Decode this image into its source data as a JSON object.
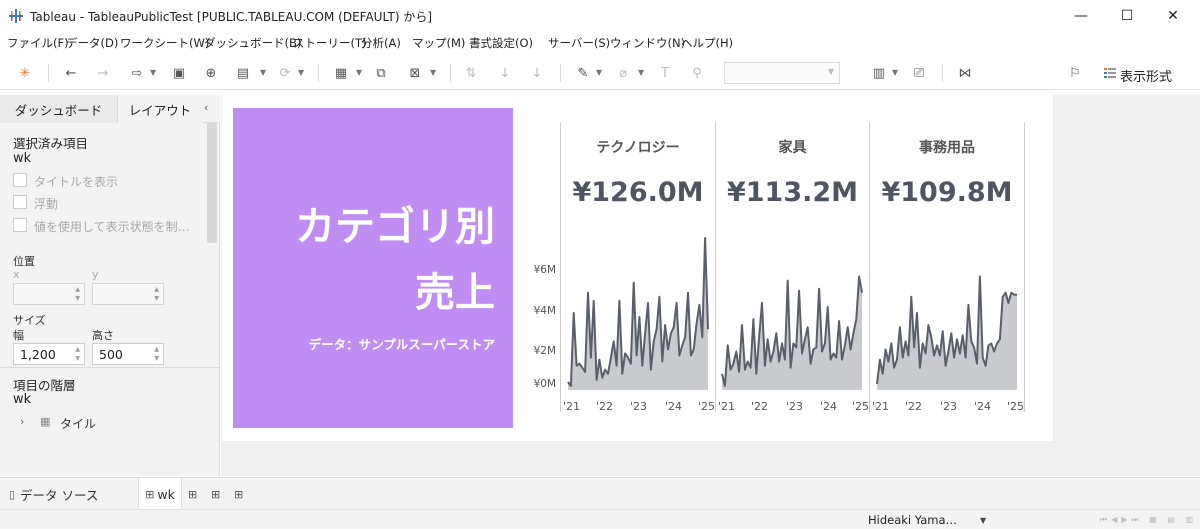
{
  "window": {
    "title": "Tableau - TableauPublicTest [PUBLIC.TABLEAU.COM (DEFAULT) から]",
    "minimize": "—",
    "maximize": "☐",
    "close": "✕"
  },
  "menu": [
    "ファイル(F)",
    "データ(D)",
    "ワークシート(W)",
    "ダッシュボード(B)",
    "ストーリー(T)",
    "分析(A)",
    "マップ(M)",
    "書式設定(O)",
    "サーバー(S)",
    "ウィンドウ(N)",
    "ヘルプ(H)"
  ],
  "toolbar": {
    "show_me_label": "表示形式",
    "icons": [
      "tableau-logo-icon",
      "back-icon",
      "forward-icon",
      "redo-icon",
      "save-icon",
      "new-datasource-icon",
      "pause-icon",
      "refresh-icon",
      "new-sheet-icon",
      "duplicate-icon",
      "clear-icon",
      "swap-icon",
      "sort-asc-icon",
      "sort-desc-icon",
      "highlight-icon",
      "paperclip-icon",
      "text-icon",
      "pin-icon",
      "presentation-icon",
      "device-preview-icon",
      "share-icon",
      "format-icon"
    ]
  },
  "left_pane": {
    "tabs": [
      "ダッシュボード",
      "レイアウト"
    ],
    "active_tab": "レイアウト",
    "selected_item_header": "選択済み項目",
    "selected_item_value": "wk",
    "checkboxes": [
      "タイトルを表示",
      "浮動",
      "値を使用して表示状態を制…"
    ],
    "position_label": "位置",
    "x_label": "x",
    "y_label": "y",
    "size_label": "サイズ",
    "width_label": "幅",
    "height_label": "高さ",
    "width_value": "1,200",
    "height_value": "500",
    "hierarchy_header": "項目の階層",
    "hierarchy_value": "wk",
    "hierarchy_child": "タイル"
  },
  "dashboard": {
    "title_line1": "カテゴリ別",
    "title_line2": "売上",
    "subtitle": "データ：サンプルスーパーストア",
    "accent": "#c08ef2",
    "line_color": "#5a6069",
    "fill_color": "#c9cbcf"
  },
  "chart_data": [
    {
      "type": "area",
      "title": "テクノロジー",
      "kpi": "¥126.0M",
      "x_ticks": [
        "'21",
        "'22",
        "'23",
        "'24",
        "'25"
      ],
      "y_ticks": [
        "¥0M",
        "¥2M",
        "¥4M",
        "¥6M"
      ],
      "ylim": [
        0,
        7.5
      ],
      "values": [
        0.4,
        0.2,
        3.8,
        1.2,
        1.3,
        1.1,
        0.9,
        4.8,
        1.6,
        4.4,
        0.5,
        1.5,
        0.6,
        1.0,
        0.8,
        1.6,
        2.4,
        1.2,
        4.4,
        0.8,
        1.8,
        1.6,
        1.3,
        5.3,
        1.7,
        3.6,
        1.2,
        2.8,
        4.3,
        1.0,
        2.4,
        3.0,
        4.6,
        1.4,
        3.2,
        2.0,
        2.8,
        3.1,
        4.3,
        1.7,
        2.2,
        2.6,
        4.8,
        1.7,
        2.0,
        3.3,
        4.2,
        2.6,
        7.5,
        3.0
      ]
    },
    {
      "type": "area",
      "title": "家具",
      "kpi": "¥113.2M",
      "x_ticks": [
        "'21",
        "'22",
        "'23",
        "'24",
        "'25"
      ],
      "y_ticks": [],
      "ylim": [
        0,
        7.5
      ],
      "values": [
        0.8,
        0.2,
        2.2,
        1.0,
        1.3,
        1.9,
        0.9,
        3.2,
        1.0,
        1.4,
        1.1,
        3.5,
        0.8,
        2.6,
        4.3,
        1.2,
        2.5,
        1.4,
        1.9,
        2.8,
        1.4,
        2.3,
        1.5,
        5.4,
        1.1,
        2.3,
        2.1,
        4.9,
        1.8,
        2.5,
        3.1,
        1.3,
        2.0,
        2.1,
        5.0,
        1.9,
        2.3,
        4.1,
        1.5,
        1.8,
        1.6,
        3.4,
        1.5,
        2.2,
        3.1,
        2.0,
        2.8,
        3.5,
        5.6,
        4.8
      ]
    },
    {
      "type": "area",
      "title": "事務用品",
      "kpi": "¥109.8M",
      "x_ticks": [
        "'21",
        "'22",
        "'23",
        "'24",
        "'25"
      ],
      "y_ticks": [],
      "ylim": [
        0,
        7.5
      ],
      "values": [
        0.3,
        1.5,
        0.8,
        2.0,
        1.4,
        2.3,
        1.1,
        1.5,
        3.1,
        1.6,
        2.4,
        1.7,
        4.6,
        2.1,
        3.8,
        1.1,
        2.3,
        1.8,
        3.2,
        2.6,
        1.7,
        2.2,
        1.7,
        2.9,
        1.2,
        1.9,
        2.8,
        1.6,
        2.5,
        1.8,
        2.7,
        1.6,
        4.2,
        2.4,
        2.1,
        1.3,
        5.6,
        1.6,
        1.2,
        2.2,
        2.3,
        1.9,
        2.3,
        2.5,
        4.6,
        4.8,
        4.3,
        4.8,
        4.7,
        4.7
      ]
    }
  ],
  "bottom": {
    "datasource_tab": "データ ソース",
    "sheet_tab": "wk",
    "user": "Hideaki Yama…"
  }
}
